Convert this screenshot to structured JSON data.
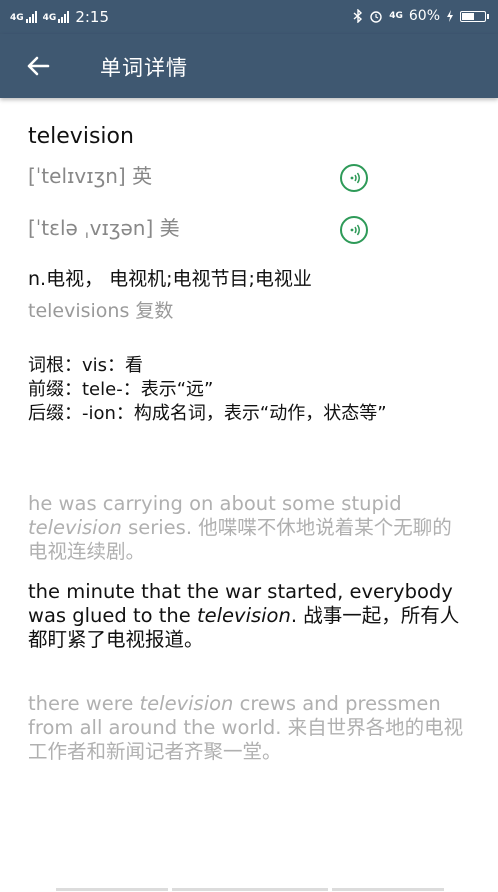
{
  "status": {
    "time": "2:15",
    "net1": "4G",
    "net2": "4G",
    "net3": "4G",
    "battery_text": "60%",
    "battery_level": 0.6
  },
  "appbar": {
    "title": "单词详情"
  },
  "word": {
    "headword": "television",
    "uk_phonetic": "[ˈtelɪvɪʒn] 英",
    "us_phonetic": "[ˈtɛlə ˌvɪʒən] 美",
    "meaning": "n.电视， 电视机;电视节目;电视业",
    "plural": "televisions  复数"
  },
  "etymology": {
    "line1": "词根：vis：看",
    "line2": "前缀：tele-：表示“远”",
    "line3": "后缀：-ion：构成名词，表示“动作，状态等”"
  },
  "examples": [
    {
      "pre": "he was carrying on about some stupid ",
      "em": "television",
      "post": " series. 他喋喋不休地说着某个无聊的电视连续剧。"
    },
    {
      "pre": "the minute that the war started, everybody was glued to the ",
      "em": "television",
      "post": ". 战事一起，所有人都盯紧了电视报道。"
    },
    {
      "pre": "there were ",
      "em": "television",
      "post": " crews and pressmen from all around the world. 来自世界各地的电视工作者和新闻记者齐聚一堂。"
    }
  ],
  "colors": {
    "header": "#3f5871",
    "speaker": "#2e9a58",
    "muted": "#b0b0b0"
  },
  "icons": [
    "back-arrow-icon",
    "speaker-icon",
    "bluetooth-icon",
    "alarm-icon",
    "battery-icon",
    "charging-icon"
  ]
}
